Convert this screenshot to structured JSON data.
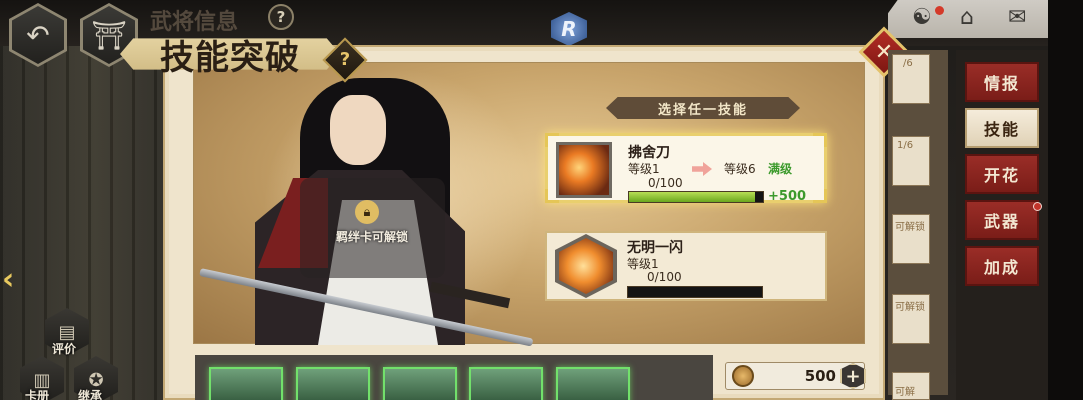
{
  "header": {
    "title": "技能突破",
    "bg_title": "武将信息",
    "badge": "R"
  },
  "left_nav": {
    "rate_label": "评价",
    "book_label": "卡册",
    "inherit_label": "继承"
  },
  "character": {
    "lock_text": "羁绊卡可解锁"
  },
  "choose": {
    "label": "选择任一技能"
  },
  "skills": [
    {
      "name": "拂舍刀",
      "level_label": "等级1",
      "target_level": "等级6",
      "maxed_label": "满级",
      "progress_text": "0/100",
      "progress_fraction": 0.94,
      "bonus": "+500",
      "selected": true
    },
    {
      "name": "无明一闪",
      "level_label": "等级1",
      "progress_text": "0/100",
      "progress_fraction": 0,
      "selected": false
    }
  ],
  "currency": {
    "amount": "500"
  },
  "side_slots": [
    "/6",
    "1/6",
    "可解锁",
    "可解锁",
    "可解"
  ],
  "right_tabs": [
    {
      "label": "情报",
      "active": false
    },
    {
      "label": "技能",
      "active": true
    },
    {
      "label": "开花",
      "active": false
    },
    {
      "label": "武器",
      "active": false
    },
    {
      "label": "加成",
      "active": false
    }
  ],
  "colors": {
    "accent_red": "#9a2d27",
    "progress_green": "#6aa71e",
    "maxed_green": "#3c9a2c",
    "panel_bg": "#efe4cc"
  }
}
